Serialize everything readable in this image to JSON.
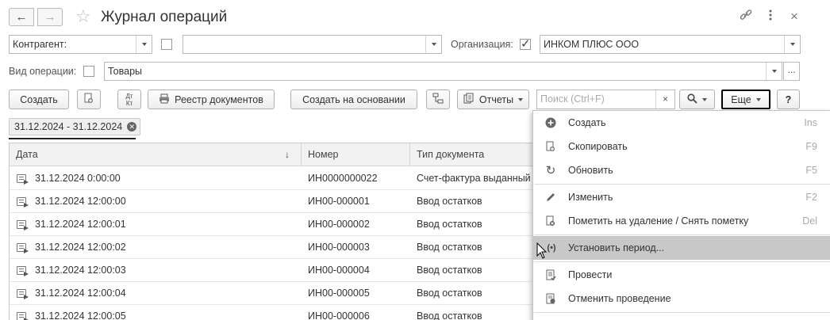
{
  "window": {
    "title": "Журнал операций",
    "back_icon": "←",
    "forward_icon": "→",
    "star_icon": "☆",
    "link_icon": "🔗",
    "more_icon": "⋮",
    "close_icon": "×"
  },
  "filters": {
    "counterparty_label": "Контрагент:",
    "counterparty_value": "",
    "counterparty_checked": false,
    "counterparty_input_value": "",
    "organization_label": "Организация:",
    "organization_checked": true,
    "organization_value": "ИНКОМ ПЛЮС ООО",
    "operation_type_label": "Вид операции:",
    "operation_type_checked": false,
    "operation_type_value": "Товары",
    "ellipsis": "..."
  },
  "toolbar": {
    "create_label": "Создать",
    "dt_kt_label": "Дт/Кт",
    "registry_label": "Реестр документов",
    "create_based_label": "Создать на основании",
    "reports_label": "Отчеты",
    "search_placeholder": "Поиск (Ctrl+F)",
    "search_clear": "×",
    "more_label": "Еще",
    "help_label": "?"
  },
  "period_chip": "31.12.2024 - 31.12.2024",
  "table": {
    "columns": [
      "Дата",
      "Номер",
      "Тип документа"
    ],
    "sort_indicator": "↓",
    "rows": [
      {
        "date": "31.12.2024 0:00:00",
        "number": "ИН0000000022",
        "type": "Счет-фактура выданный"
      },
      {
        "date": "31.12.2024 12:00:00",
        "number": "ИН00-000001",
        "type": "Ввод остатков"
      },
      {
        "date": "31.12.2024 12:00:01",
        "number": "ИН00-000002",
        "type": "Ввод остатков"
      },
      {
        "date": "31.12.2024 12:00:02",
        "number": "ИН00-000003",
        "type": "Ввод остатков"
      },
      {
        "date": "31.12.2024 12:00:03",
        "number": "ИН00-000004",
        "type": "Ввод остатков"
      },
      {
        "date": "31.12.2024 12:00:04",
        "number": "ИН00-000005",
        "type": "Ввод остатков"
      },
      {
        "date": "31.12.2024 12:00:05",
        "number": "ИН00-000006",
        "type": "Ввод остатков"
      }
    ]
  },
  "menu": {
    "items": [
      {
        "label": "Создать",
        "shortcut": "Ins",
        "icon": "plus-circle-icon"
      },
      {
        "label": "Скопировать",
        "shortcut": "F9",
        "icon": "copy-icon"
      },
      {
        "label": "Обновить",
        "shortcut": "F5",
        "icon": "refresh-icon"
      },
      {
        "label": "Изменить",
        "shortcut": "F2",
        "icon": "pencil-icon"
      },
      {
        "label": "Пометить на удаление / Снять пометку",
        "shortcut": "Del",
        "icon": "delete-mark-icon"
      },
      {
        "label": "Установить период...",
        "shortcut": "",
        "icon": "set-period-icon"
      },
      {
        "label": "Провести",
        "shortcut": "",
        "icon": "post-document-icon"
      },
      {
        "label": "Отменить проведение",
        "shortcut": "",
        "icon": "unpost-document-icon"
      }
    ]
  }
}
